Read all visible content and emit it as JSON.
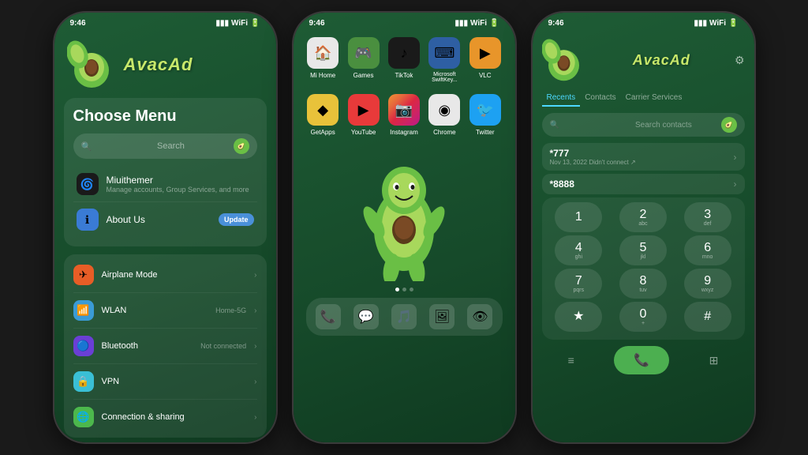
{
  "phone1": {
    "status_time": "9:46",
    "brand": "AvacAd",
    "choose_menu": "Choose Menu",
    "search_placeholder": "Search",
    "menu_items": [
      {
        "icon": "🌀",
        "icon_bg": "#1a1a1a",
        "title": "Miuithemer",
        "subtitle": "Manage accounts, Group Services, and more"
      },
      {
        "icon": "ℹ",
        "icon_bg": "#3a7bd5",
        "title": "About Us",
        "has_update": true,
        "update_label": "Update"
      }
    ],
    "settings_items": [
      {
        "icon": "✈",
        "icon_bg": "#e85d26",
        "title": "Airplane Mode",
        "value": ""
      },
      {
        "icon": "📶",
        "icon_bg": "#3a9bd5",
        "title": "WLAN",
        "value": "Home-5G"
      },
      {
        "icon": "🔵",
        "icon_bg": "#6a3fd5",
        "title": "Bluetooth",
        "value": "Not connected"
      },
      {
        "icon": "🔒",
        "icon_bg": "#3abfd5",
        "title": "VPN",
        "value": ""
      },
      {
        "icon": "🌐",
        "icon_bg": "#4cb84c",
        "title": "Connection & sharing",
        "value": ""
      }
    ]
  },
  "phone2": {
    "status_time": "9:46",
    "apps_row1": [
      {
        "label": "Mi Home",
        "icon": "🏠",
        "bg": "#e8e8e8"
      },
      {
        "label": "Games",
        "icon": "🎮",
        "bg": "#4a8f3f"
      },
      {
        "label": "TikTok",
        "icon": "♪",
        "bg": "#1a1a1a"
      },
      {
        "label": "Microsoft SwiftKey...",
        "icon": "⌨",
        "bg": "#2e5fa3"
      },
      {
        "label": "VLC",
        "icon": "▶",
        "bg": "#e8952a"
      }
    ],
    "apps_row2": [
      {
        "label": "GetApps",
        "icon": "◆",
        "bg": "#e8c23a"
      },
      {
        "label": "YouTube",
        "icon": "▶",
        "bg": "#e83a3a"
      },
      {
        "label": "Instagram",
        "icon": "📷",
        "bg": "#d44a9c"
      },
      {
        "label": "Chrome",
        "icon": "◉",
        "bg": "#e8e8e8"
      },
      {
        "label": "Twitter",
        "icon": "🐦",
        "bg": "#1da1f2"
      }
    ],
    "dock_icons": [
      "📞",
      "💬",
      "🎵",
      "🖼",
      "👁"
    ]
  },
  "phone3": {
    "status_time": "9:46",
    "tabs": [
      "Recents",
      "Contacts",
      "Carrier Services"
    ],
    "active_tab": 0,
    "search_placeholder": "Search contacts",
    "recents": [
      {
        "number": "*777",
        "date": "Nov 13, 2022 Didn't connect ↗"
      },
      {
        "number": "*8888",
        "date": ""
      }
    ],
    "keypad": [
      [
        {
          "main": "1",
          "sub": ""
        },
        {
          "main": "2",
          "sub": "abc"
        },
        {
          "main": "3",
          "sub": "def"
        }
      ],
      [
        {
          "main": "4",
          "sub": "ghi"
        },
        {
          "main": "5",
          "sub": "jkl"
        },
        {
          "main": "6",
          "sub": "mno"
        }
      ],
      [
        {
          "main": "7",
          "sub": "pqrs"
        },
        {
          "main": "8",
          "sub": "tuv"
        },
        {
          "main": "9",
          "sub": "wxyz"
        }
      ],
      [
        {
          "main": "★",
          "sub": ""
        },
        {
          "main": "0",
          "sub": "+"
        },
        {
          "main": "#",
          "sub": ""
        }
      ]
    ],
    "call_label": "📞",
    "gear_label": "⚙"
  }
}
